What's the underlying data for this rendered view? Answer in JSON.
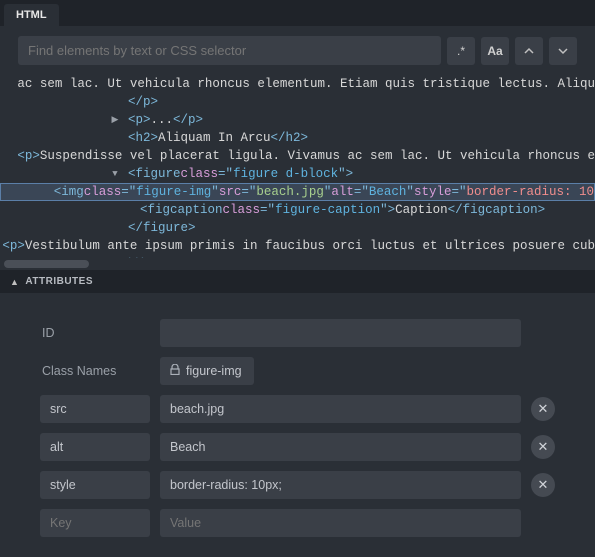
{
  "tab": {
    "label": "HTML"
  },
  "search": {
    "placeholder": "Find elements by text or CSS selector",
    "toggleExact": ".*",
    "toggleCase": "Aa"
  },
  "tree": {
    "line0_suffix": "ac sem lac. Ut vehicula rhoncus elementum. Etiam quis tristique lectus. Aliqu",
    "p_close": "</p>",
    "p_ellipsis_open": "<p>",
    "p_ellipsis_text": "...",
    "p_ellipsis_close": "</p>",
    "h2_open": "<h2>",
    "h2_text": "Aliquam In Arcu ",
    "h2_close": "</h2>",
    "p2_open": "<p>",
    "p2_text": "Suspendisse vel placerat ligula. Vivamus ac sem lac. Ut vehicula rhoncus e",
    "fig_tag": "figure",
    "fig_class": "figure d-block",
    "img_tag": "img",
    "img_class": "figure-img",
    "img_src": "beach.jpg",
    "img_alt": "Beach",
    "img_style": "border-radius: 10",
    "cap_tag": "figcaption",
    "cap_class": "figure-caption",
    "cap_text": "Caption",
    "fig_close": "</figure>",
    "p3_open": "<p>",
    "p3_text": "Vestibulum ante ipsum primis in faucibus orci luctus et ultrices posuere cub",
    "div_close": "</div>"
  },
  "sections": {
    "attributes": "ATTRIBUTES"
  },
  "attrs": {
    "id": {
      "label": "ID",
      "value": ""
    },
    "className": {
      "label": "Class Names",
      "value": "figure-img"
    },
    "rows": [
      {
        "key": "src",
        "value": "beach.jpg"
      },
      {
        "key": "alt",
        "value": "Beach"
      },
      {
        "key": "style",
        "value": "border-radius: 10px;"
      }
    ],
    "newKey": "Key",
    "newValue": "Value"
  }
}
